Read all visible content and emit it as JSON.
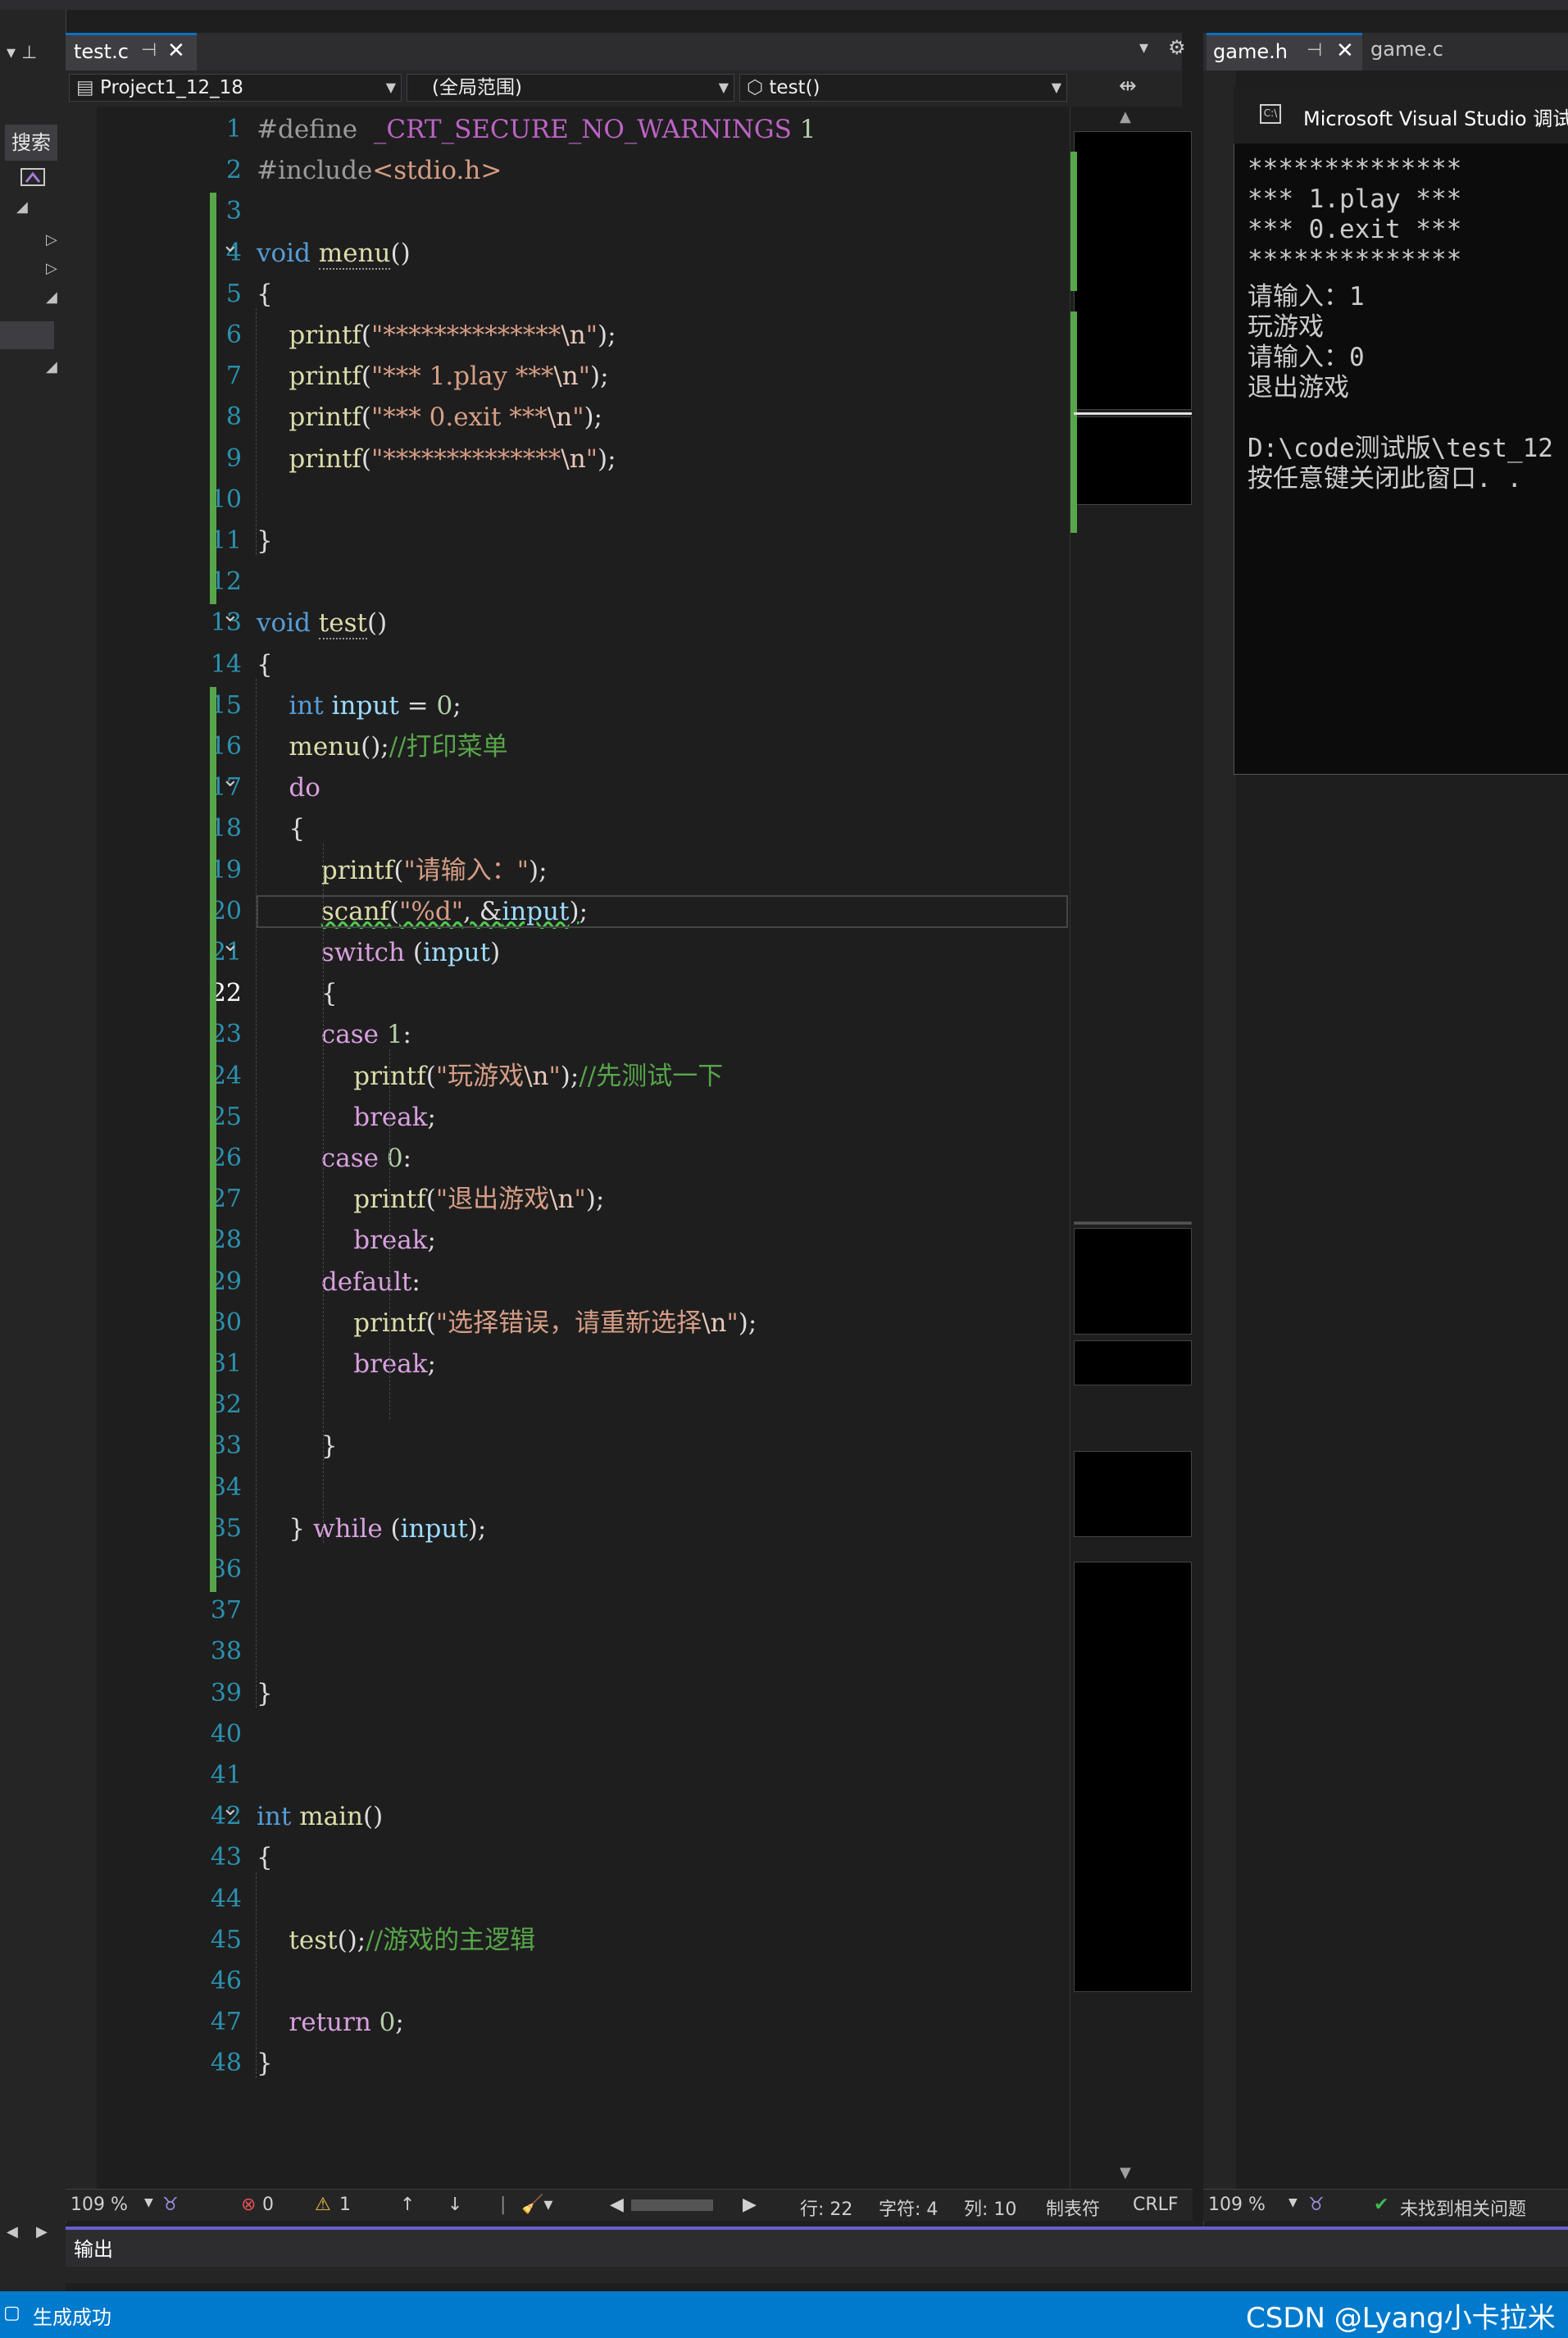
{
  "editor": {
    "tab": {
      "label": "test.c"
    },
    "nav": {
      "project": "Project1_12_18",
      "scope": "(全局范围)",
      "member": "test()"
    },
    "current_line": 22,
    "lines": [
      {
        "n": 1,
        "html": "<span class=\"pp\">#define</span>  <span class=\"mac\">_CRT_SECURE_NO_WARNINGS</span> <span class=\"num\">1</span>"
      },
      {
        "n": 2,
        "html": "<span class=\"pp\">#include</span><span class=\"inc\">&lt;stdio.h&gt;</span>"
      },
      {
        "n": 3,
        "html": ""
      },
      {
        "n": 4,
        "html": "<span class=\"kw\">void</span> <span class=\"fn dotted\">menu</span>()"
      },
      {
        "n": 5,
        "html": "{"
      },
      {
        "n": 6,
        "html": "    <span class=\"fn\">printf</span>(<span class=\"str\">\"**************</span><span class=\"esc\">\\n</span><span class=\"str\">\"</span>);"
      },
      {
        "n": 7,
        "html": "    <span class=\"fn\">printf</span>(<span class=\"str\">\"*** 1.play ***</span><span class=\"esc\">\\n</span><span class=\"str\">\"</span>);"
      },
      {
        "n": 8,
        "html": "    <span class=\"fn\">printf</span>(<span class=\"str\">\"*** 0.exit ***</span><span class=\"esc\">\\n</span><span class=\"str\">\"</span>);"
      },
      {
        "n": 9,
        "html": "    <span class=\"fn\">printf</span>(<span class=\"str\">\"**************</span><span class=\"esc\">\\n</span><span class=\"str\">\"</span>);"
      },
      {
        "n": 10,
        "html": ""
      },
      {
        "n": 11,
        "html": "}"
      },
      {
        "n": 12,
        "html": ""
      },
      {
        "n": 13,
        "html": "<span class=\"kw\">void</span> <span class=\"fn dotted\">test</span>()"
      },
      {
        "n": 14,
        "html": "{"
      },
      {
        "n": 15,
        "html": "    <span class=\"kw\">int</span> <span class=\"var\">input</span> = <span class=\"num\">0</span>;"
      },
      {
        "n": 16,
        "html": "    <span class=\"fn\">menu</span>();<span class=\"cmt\">//打印菜单</span>"
      },
      {
        "n": 17,
        "html": "    <span class=\"kw2\">do</span>"
      },
      {
        "n": 18,
        "html": "    {"
      },
      {
        "n": 19,
        "html": "        <span class=\"fn\">printf</span>(<span class=\"str\">\"请输入：\"</span>);"
      },
      {
        "n": 20,
        "html": "        <span class=\"fn squig\">scanf</span><span class=\"squig\">(<span class=\"str\">\"%d\"</span>, &amp;<span class=\"var\">input</span>)</span>;"
      },
      {
        "n": 21,
        "html": "        <span class=\"kw2\">switch</span> (<span class=\"var\">input</span>)"
      },
      {
        "n": 22,
        "html": "        {"
      },
      {
        "n": 23,
        "html": "        <span class=\"kw2\">case</span> <span class=\"num\">1</span>:"
      },
      {
        "n": 24,
        "html": "            <span class=\"fn\">printf</span>(<span class=\"str\">\"玩游戏</span><span class=\"esc\">\\n</span><span class=\"str\">\"</span>);<span class=\"cmt\">//先测试一下</span>"
      },
      {
        "n": 25,
        "html": "            <span class=\"kw2\">break</span>;"
      },
      {
        "n": 26,
        "html": "        <span class=\"kw2\">case</span> <span class=\"num\">0</span>:"
      },
      {
        "n": 27,
        "html": "            <span class=\"fn\">printf</span>(<span class=\"str\">\"退出游戏</span><span class=\"esc\">\\n</span><span class=\"str\">\"</span>);"
      },
      {
        "n": 28,
        "html": "            <span class=\"kw2\">break</span>;"
      },
      {
        "n": 29,
        "html": "        <span class=\"kw2\">default</span>:"
      },
      {
        "n": 30,
        "html": "            <span class=\"fn\">printf</span>(<span class=\"str\">\"选择错误，请重新选择</span><span class=\"esc\">\\n</span><span class=\"str\">\"</span>);"
      },
      {
        "n": 31,
        "html": "            <span class=\"kw2\">break</span>;"
      },
      {
        "n": 32,
        "html": ""
      },
      {
        "n": 33,
        "html": "        }"
      },
      {
        "n": 34,
        "html": ""
      },
      {
        "n": 35,
        "html": "    } <span class=\"kw2\">while</span> (<span class=\"var\">input</span>);"
      },
      {
        "n": 36,
        "html": ""
      },
      {
        "n": 37,
        "html": ""
      },
      {
        "n": 38,
        "html": ""
      },
      {
        "n": 39,
        "html": "}"
      },
      {
        "n": 40,
        "html": ""
      },
      {
        "n": 41,
        "html": ""
      },
      {
        "n": 42,
        "html": "<span class=\"kw\">int</span> <span class=\"fn\">main</span>()"
      },
      {
        "n": 43,
        "html": "{"
      },
      {
        "n": 44,
        "html": ""
      },
      {
        "n": 45,
        "html": "    <span class=\"fn\">test</span>();<span class=\"cmt\">//游戏的主逻辑</span>"
      },
      {
        "n": 46,
        "html": ""
      },
      {
        "n": 47,
        "html": "    <span class=\"kw2\">return</span> <span class=\"num\">0</span>;"
      },
      {
        "n": 48,
        "html": "}"
      }
    ],
    "status": {
      "zoom": "109 %",
      "errors": "0",
      "warnings": "1",
      "line": "行: 22",
      "char": "字符: 4",
      "col": "列: 10",
      "tabs": "制表符",
      "eol": "CRLF"
    }
  },
  "right_panel": {
    "tab_active": "game.h",
    "tab_other": "game.c",
    "status": {
      "zoom": "109 %",
      "issues": "未找到相关问题"
    }
  },
  "console": {
    "title": "Microsoft Visual Studio 调试控",
    "lines": [
      "**************",
      "*** 1.play ***",
      "*** 0.exit ***",
      "**************",
      "请输入：1",
      "玩游戏",
      "请输入：0",
      "退出游戏",
      "",
      "D:\\code测试版\\test_12",
      "按任意键关闭此窗口. ."
    ]
  },
  "left_strip": {
    "search_label": "搜索"
  },
  "output_panel": {
    "title": "输出"
  },
  "status_bar": {
    "message": "生成成功"
  },
  "watermark": "CSDN @Lyang小卡拉米",
  "colors": {
    "accent": "#007acc",
    "change_bar": "#57a64a",
    "line_number": "#2b91af"
  }
}
